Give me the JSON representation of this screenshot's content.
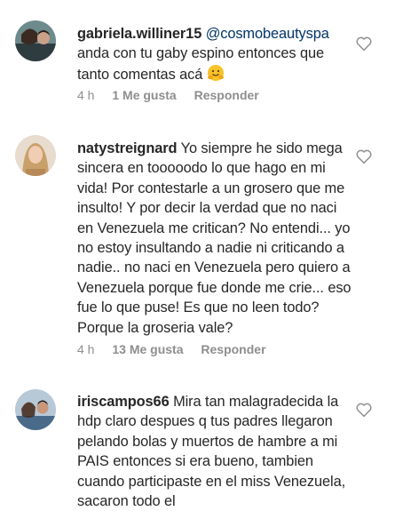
{
  "comments": [
    {
      "username": "gabriela.williner15",
      "mention": "@cosmobeautyspa",
      "text": "anda con tu gaby espino entonces que tanto comentas acá",
      "emoji_icon": "hugging-face-emoji",
      "time": "4 h",
      "likes": "1 Me gusta",
      "reply": "Responder"
    },
    {
      "username": "natystreignard",
      "mention": "",
      "text": "Yo siempre he sido mega sincera en tooooodo lo que hago en mi vida! Por contestarle a un grosero que me insulto! Y por decir la verdad que no naci en Venezuela me critican? No entendi... yo no estoy insultando a nadie ni criticando a nadie.. no naci en Venezuela pero quiero a Venezuela porque fue donde me crie... eso fue lo que puse! Es que no leen todo? Porque la groseria vale?",
      "time": "4 h",
      "likes": "13 Me gusta",
      "reply": "Responder"
    },
    {
      "username": "iriscampos66",
      "mention": "",
      "text": "Mira tan malagradecida la hdp claro despues q tus padres llegaron pelando bolas y muertos de hambre a mi PAIS entonces si era bueno, tambien cuando participaste en el miss Venezuela, sacaron todo el",
      "time": "",
      "likes": "",
      "reply": ""
    }
  ],
  "colors": {
    "text": "#262626",
    "mention": "#003569",
    "meta": "#8e8e8e",
    "heart_outline": "#8e8e8e"
  }
}
